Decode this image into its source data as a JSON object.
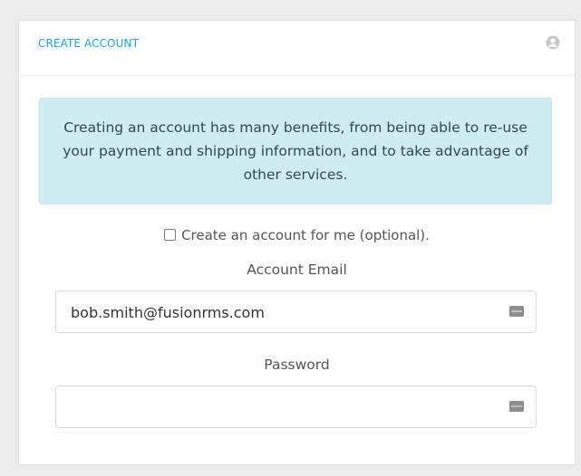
{
  "card": {
    "title": "CREATE ACCOUNT",
    "header_icon": "user-circle-icon"
  },
  "info": {
    "text": "Creating an account has many benefits, from being able to re-use your payment and shipping information, and to take advantage of other services."
  },
  "create_account": {
    "label": "Create an account for me (optional).",
    "checked": false
  },
  "email": {
    "label": "Account Email",
    "value": "bob.smith@fusionrms.com",
    "icon": "password-manager-icon"
  },
  "password": {
    "label": "Password",
    "value": "",
    "icon": "password-manager-icon"
  },
  "colors": {
    "accent": "#1aa7d8",
    "info_bg": "#cfecf0",
    "page_bg": "#ececec"
  }
}
